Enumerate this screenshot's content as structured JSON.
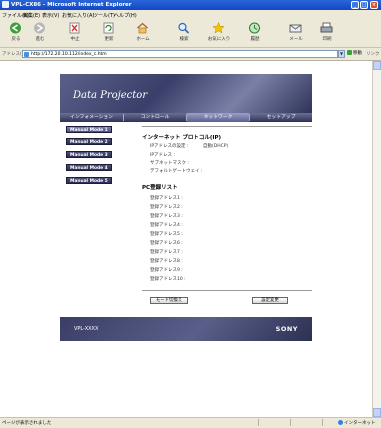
{
  "window": {
    "title": "VPL-CX86 - Microsoft Internet Explorer",
    "controls": [
      "_",
      "□",
      "×"
    ]
  },
  "menu": {
    "items": [
      "ファイル(F)",
      "編集(E)",
      "表示(V)",
      "お気に入り(A)",
      "ツール(T)",
      "ヘルプ(H)"
    ]
  },
  "toolbar": {
    "buttons": [
      "戻る",
      "進む",
      "中止",
      "更新",
      "ホーム",
      "検索",
      "お気に入り",
      "履歴",
      "メール",
      "印刷"
    ]
  },
  "address": {
    "label": "アドレス(D)",
    "url": "http://172.20.10.112/index_c.htm",
    "go_label": "移動",
    "links_label": "リンク"
  },
  "page": {
    "banner_title": "Data Projector",
    "nav_tabs": [
      "インフォメーション",
      "コントロール",
      "ネットワーク",
      "セットアップ"
    ],
    "active_tab": "ネットワーク",
    "sidebar": [
      "Manual Mode 1",
      "Manual Mode 2",
      "Manual Mode 3",
      "Manual Mode 4",
      "Manual Mode 5"
    ],
    "active_sidebar": "Manual Mode 1",
    "ip_section": {
      "title": "インターネット プロトコル(IP)",
      "rows": [
        {
          "label": "IPアドレスの設定 :",
          "value": "自動(DHCP)"
        },
        {
          "label": "IPアドレス :",
          "value": ""
        },
        {
          "label": "サブネットマスク :",
          "value": ""
        },
        {
          "label": "デフォルトゲートウェイ :",
          "value": ""
        }
      ]
    },
    "pc_section": {
      "title": "PC登録リスト",
      "rows": [
        "登録アドレス1 :",
        "登録アドレス2 :",
        "登録アドレス3 :",
        "登録アドレス4 :",
        "登録アドレス5 :",
        "登録アドレス6 :",
        "登録アドレス7 :",
        "登録アドレス8 :",
        "登録アドレス9 :",
        "登録アドレス10 :"
      ]
    },
    "buttons": {
      "mode_switch": "モード切換え",
      "apply": "設定変更"
    },
    "footer": {
      "model": "VPL-XXXX",
      "logo": "SONY"
    }
  },
  "status": {
    "left": "ページが表示されました",
    "zone": "インターネット"
  },
  "colors": {
    "titlebar": "#1346c4",
    "banner": "#3a3f6a",
    "sidebar_button": "#2b2e52"
  }
}
